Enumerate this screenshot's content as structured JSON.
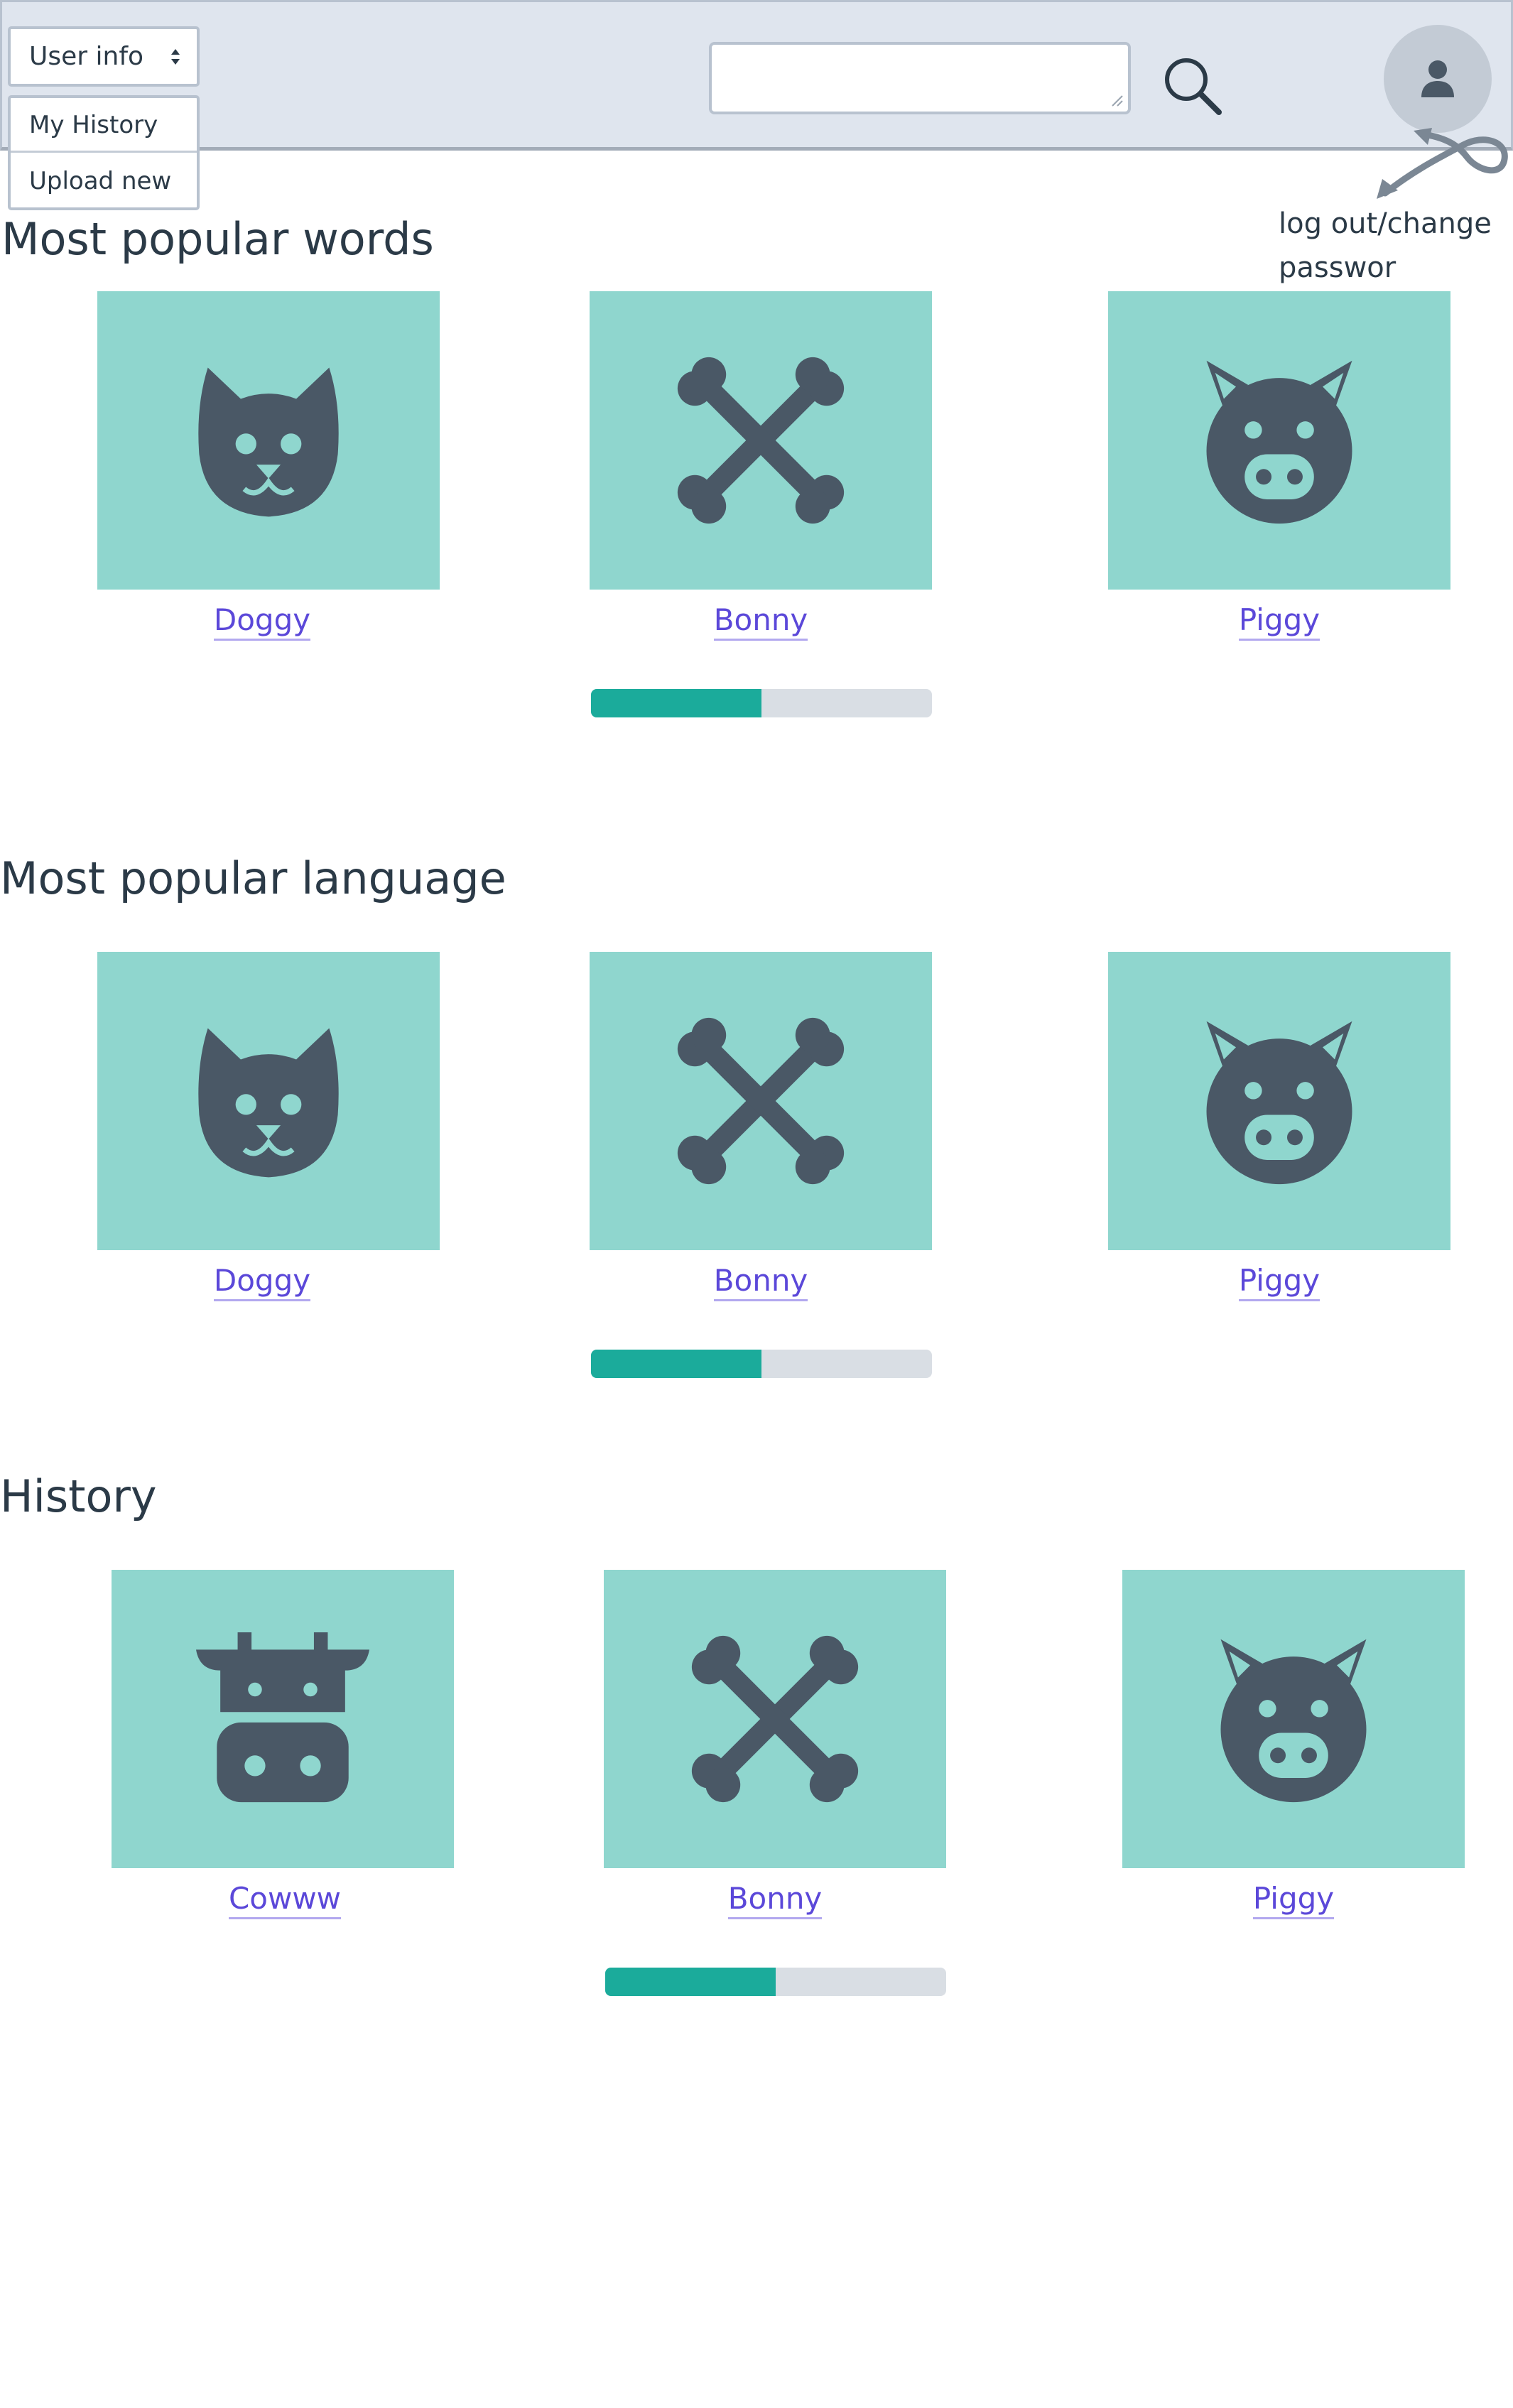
{
  "header": {
    "user_select": {
      "selected": "User info"
    },
    "menu": {
      "items": [
        "My History",
        "Upload new"
      ]
    },
    "search": {
      "placeholder": "",
      "value": ""
    },
    "annotation": "log out/change passwor"
  },
  "sections": [
    {
      "title": "Most popular words",
      "cards": [
        {
          "label": "Doggy",
          "icon": "cat-icon"
        },
        {
          "label": "Bonny",
          "icon": "bone-icon"
        },
        {
          "label": "Piggy",
          "icon": "pig-icon"
        }
      ],
      "progress": 0.5
    },
    {
      "title": "Most popular language",
      "cards": [
        {
          "label": "Doggy",
          "icon": "cat-icon"
        },
        {
          "label": "Bonny",
          "icon": "bone-icon"
        },
        {
          "label": "Piggy",
          "icon": "pig-icon"
        }
      ],
      "progress": 0.5
    },
    {
      "title": "History",
      "cards": [
        {
          "label": "Cowww",
          "icon": "cow-icon"
        },
        {
          "label": "Bonny",
          "icon": "bone-icon"
        },
        {
          "label": "Piggy",
          "icon": "pig-icon"
        }
      ],
      "progress": 0.5
    }
  ],
  "colors": {
    "header_bg": "#dfe5ee",
    "tile_bg": "#8fd6ce",
    "icon": "#4a5866",
    "link": "#5b48d9",
    "progress_fill": "#1bab9b",
    "progress_track": "#d9dee4"
  }
}
